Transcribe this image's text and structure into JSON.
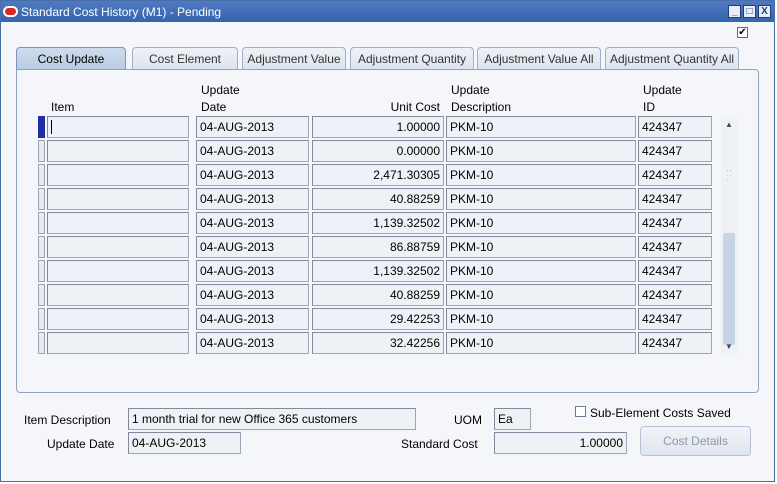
{
  "window": {
    "title": "Standard Cost History (M1) - Pending",
    "minimize": "",
    "maximize": "",
    "close": "X"
  },
  "top_checkbox": "✔",
  "tabs": [
    {
      "label": "Cost Update",
      "active": true
    },
    {
      "label": "Cost Element",
      "active": false
    },
    {
      "label": "Adjustment Value",
      "active": false
    },
    {
      "label": "Adjustment Quantity",
      "active": false
    },
    {
      "label": "Adjustment Value All",
      "active": false
    },
    {
      "label": "Adjustment Quantity All",
      "active": false
    }
  ],
  "table": {
    "headers": {
      "item": "Item",
      "update_date_1": "Update",
      "update_date_2": "Date",
      "unit_cost": "Unit Cost",
      "update_desc_1": "Update",
      "update_desc_2": "Description",
      "update_id_1": "Update",
      "update_id_2": "ID"
    },
    "rows": [
      {
        "item": "",
        "date": "04-AUG-2013",
        "unit_cost": "1.00000",
        "description": "PKM-10",
        "id": "424347"
      },
      {
        "item": "",
        "date": "04-AUG-2013",
        "unit_cost": "0.00000",
        "description": "PKM-10",
        "id": "424347"
      },
      {
        "item": "",
        "date": "04-AUG-2013",
        "unit_cost": "2,471.30305",
        "description": "PKM-10",
        "id": "424347"
      },
      {
        "item": "",
        "date": "04-AUG-2013",
        "unit_cost": "40.88259",
        "description": "PKM-10",
        "id": "424347"
      },
      {
        "item": "",
        "date": "04-AUG-2013",
        "unit_cost": "1,139.32502",
        "description": "PKM-10",
        "id": "424347"
      },
      {
        "item": "",
        "date": "04-AUG-2013",
        "unit_cost": "86.88759",
        "description": "PKM-10",
        "id": "424347"
      },
      {
        "item": "",
        "date": "04-AUG-2013",
        "unit_cost": "1,139.32502",
        "description": "PKM-10",
        "id": "424347"
      },
      {
        "item": "",
        "date": "04-AUG-2013",
        "unit_cost": "40.88259",
        "description": "PKM-10",
        "id": "424347"
      },
      {
        "item": "",
        "date": "04-AUG-2013",
        "unit_cost": "29.42253",
        "description": "PKM-10",
        "id": "424347"
      },
      {
        "item": "",
        "date": "04-AUG-2013",
        "unit_cost": "32.42256",
        "description": "PKM-10",
        "id": "424347"
      }
    ]
  },
  "footer": {
    "item_description_label": "Item Description",
    "item_description_value": "1 month trial for new Office 365 customers",
    "uom_label": "UOM",
    "uom_value": "Ea",
    "sub_element_label": "Sub-Element Costs Saved",
    "update_date_label": "Update Date",
    "update_date_value": "04-AUG-2013",
    "standard_cost_label": "Standard Cost",
    "standard_cost_value": "1.00000",
    "cost_details_button": "Cost Details"
  },
  "icons": {
    "app_logo": "oracle-logo-icon",
    "scroll_up": "▲",
    "scroll_down": "▼",
    "grip": "∴"
  }
}
